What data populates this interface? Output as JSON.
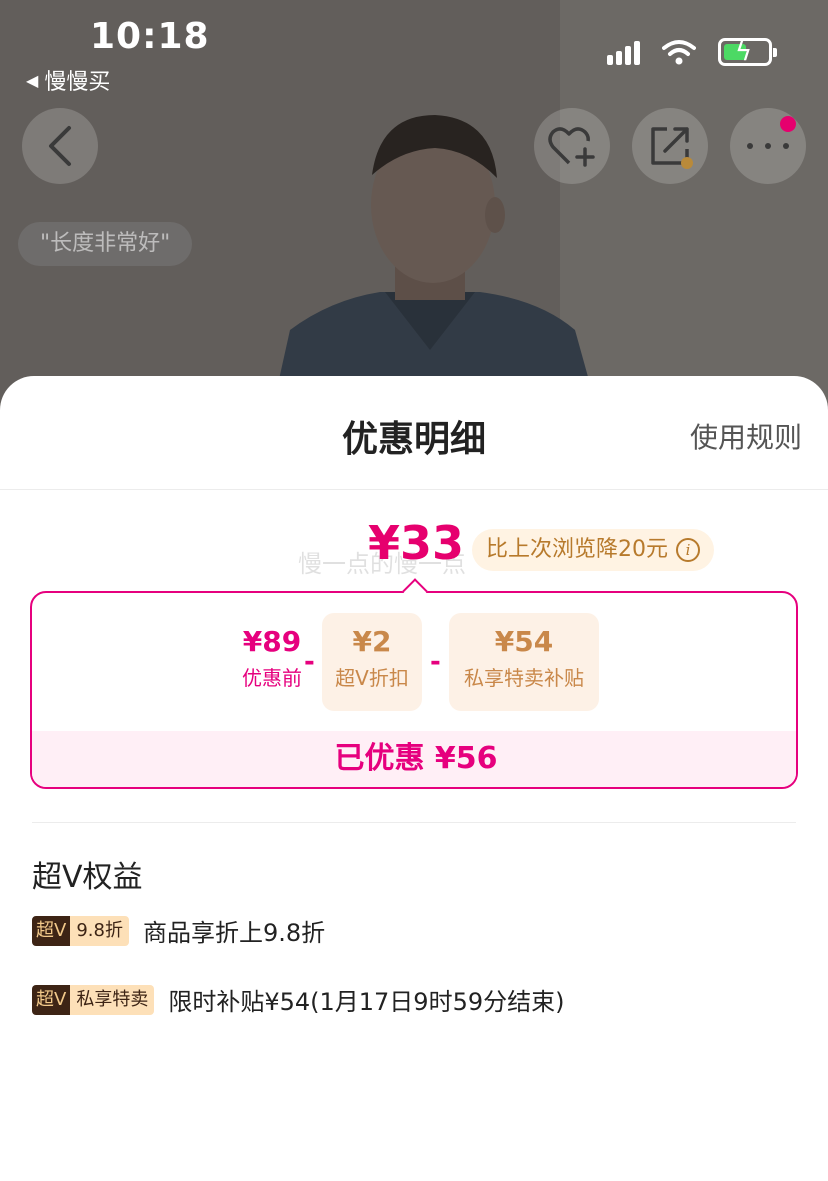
{
  "status_bar": {
    "time": "10:18",
    "back_app": "慢慢买"
  },
  "product": {
    "tag": "\"长度非常好\""
  },
  "sheet": {
    "title": "优惠明细",
    "rules_link": "使用规则",
    "final_price": "¥33",
    "ghost_text": "慢一点的慢一点",
    "price_drop": "比上次浏览降20元",
    "calc": {
      "items": [
        {
          "amount": "¥89",
          "label": "优惠前"
        },
        {
          "amount": "¥2",
          "label": "超V折扣"
        },
        {
          "amount": "¥54",
          "label": "私享特卖补贴"
        }
      ],
      "minus": "-",
      "saved": "已优惠 ¥56"
    },
    "benefits_title": "超V权益",
    "benefits": [
      {
        "badge_left": "超V",
        "badge_right": "9.8折",
        "text": "商品享折上9.8折"
      },
      {
        "badge_left": "超V",
        "badge_right": "私享特卖",
        "text": "限时补贴¥54(1月17日9时59分结束)"
      }
    ]
  },
  "colors": {
    "accent": "#e6007e",
    "gold": "#c9884a",
    "badge_dark": "#3d2415"
  }
}
